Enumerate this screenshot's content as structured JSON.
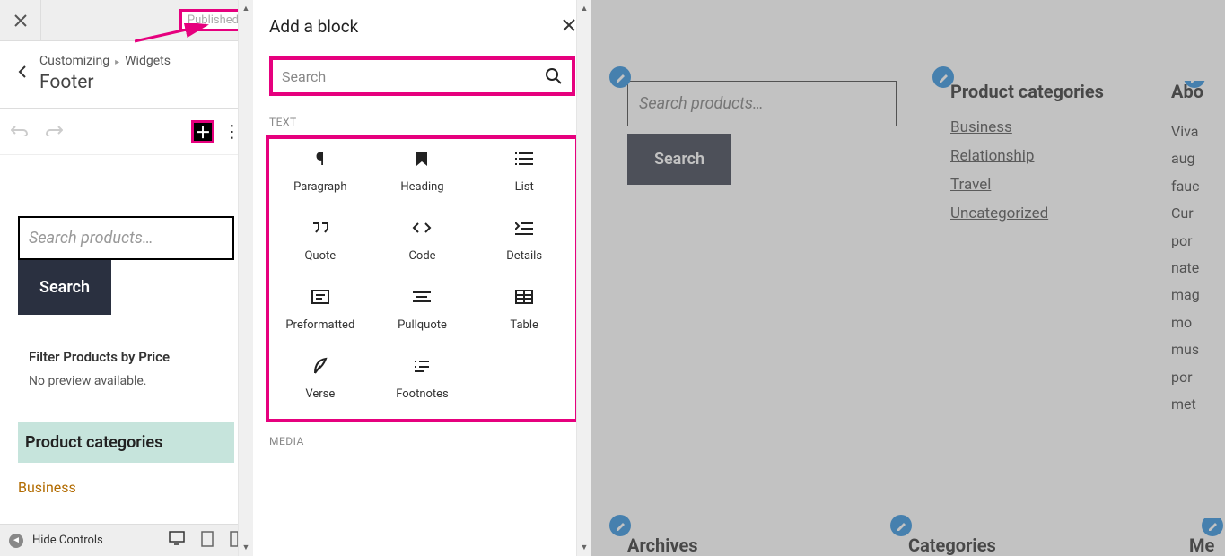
{
  "topbar": {
    "published_label": "Published"
  },
  "breadcrumb": {
    "part1": "Customizing",
    "part2": "Widgets"
  },
  "section_title": "Footer",
  "preview": {
    "search_placeholder": "Search products…",
    "search_label": "Search",
    "filter_title": "Filter Products by Price",
    "filter_msg": "No preview available.",
    "prod_cat_title": "Product categories",
    "cat_item": "Business"
  },
  "bottom": {
    "hide_label": "Hide Controls"
  },
  "inserter": {
    "title": "Add a block",
    "search_ph": "Search",
    "group_text": "TEXT",
    "group_media": "MEDIA",
    "blocks": [
      "Paragraph",
      "Heading",
      "List",
      "Quote",
      "Code",
      "Details",
      "Preformatted",
      "Pullquote",
      "Table",
      "Verse",
      "Footnotes"
    ]
  },
  "live": {
    "search_ph": "Search products…",
    "search_label": "Search",
    "col2_title": "Product categories",
    "col2_links": [
      "Business",
      "Relationship",
      "Travel",
      "Uncategorized"
    ],
    "col3_title": "Abo",
    "col3_lines": [
      "Viva",
      "aug",
      "fauc",
      "Cur",
      "por",
      "nate",
      "mag",
      "mo",
      "mus",
      "por",
      "met"
    ],
    "bot1": "Archives",
    "bot2": "Categories",
    "bot3": "Me"
  }
}
